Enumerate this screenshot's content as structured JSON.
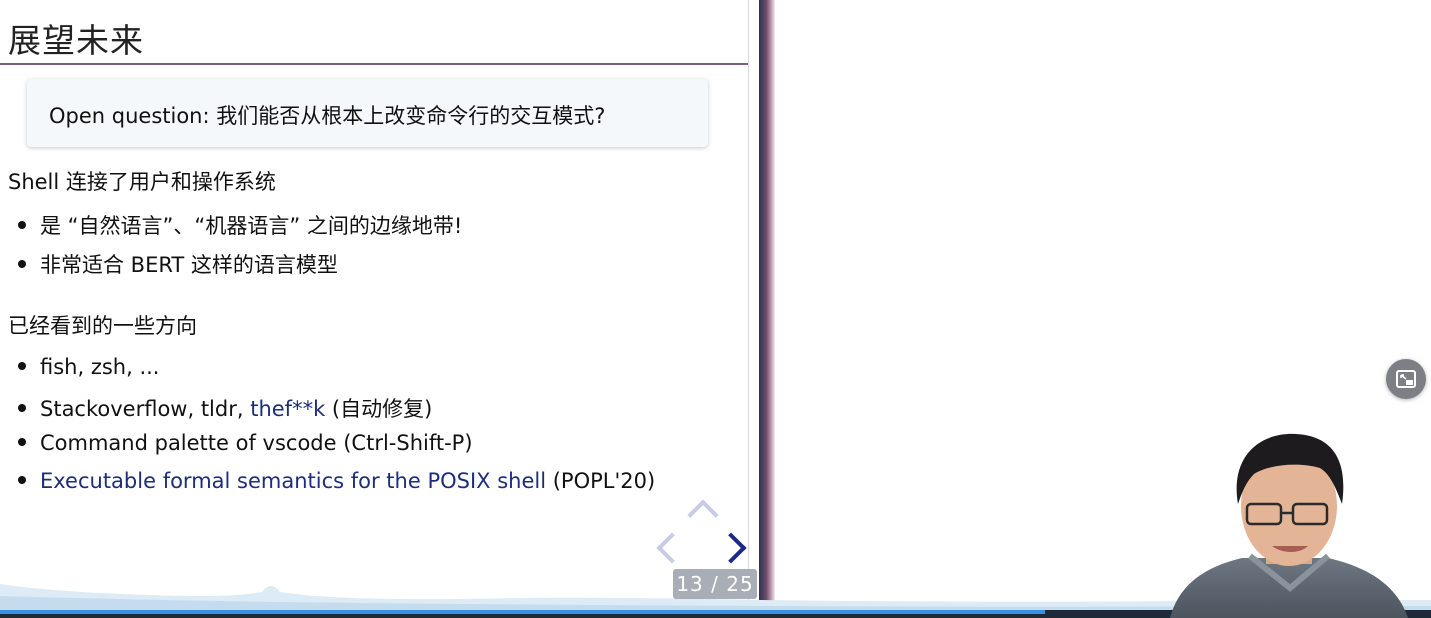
{
  "slide": {
    "title": "展望未来",
    "callout": "Open question: 我们能否从根本上改变命令行的交互模式?",
    "section1": {
      "heading": "Shell 连接了用户和操作系统",
      "bullets": [
        "是 “自然语言”、“机器语言” 之间的边缘地带!",
        "非常适合 BERT 这样的语言模型"
      ]
    },
    "section2": {
      "heading": "已经看到的一些方向",
      "bullets": [
        {
          "text": "fish, zsh, ..."
        },
        {
          "prefix": "Stackoverflow, tldr, ",
          "link": "thef**k",
          "suffix": " (自动修复)"
        },
        {
          "text": "Command palette of vscode (Ctrl-Shift-P)"
        },
        {
          "link": "Executable formal semantics for the POSIX shell",
          "suffix": " (POPL'20)"
        }
      ]
    },
    "page_counter": "13 / 25",
    "link_color": "#1d2d7a"
  },
  "navigation": {
    "up_icon": "chevron-up-icon",
    "left_icon": "chevron-left-icon",
    "right_icon": "chevron-right-icon"
  },
  "overlay": {
    "pip_icon": "picture-in-picture-exit-icon"
  },
  "progress": {
    "fraction": 0.73
  }
}
